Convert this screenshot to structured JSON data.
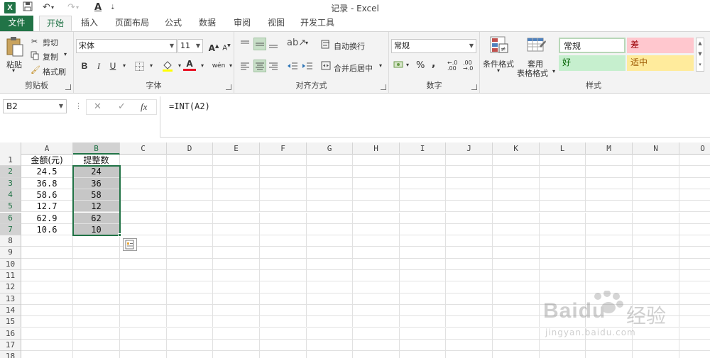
{
  "app": {
    "title": "记录 - Excel",
    "logo_letter": "X"
  },
  "tabs": [
    "文件",
    "开始",
    "插入",
    "页面布局",
    "公式",
    "数据",
    "审阅",
    "视图",
    "开发工具"
  ],
  "ribbon": {
    "clipboard": {
      "paste": "粘贴",
      "cut": "剪切",
      "copy": "复制",
      "format_painter": "格式刷",
      "label": "剪贴板"
    },
    "font": {
      "name": "宋体",
      "size": "11",
      "bold": "B",
      "italic": "I",
      "underline": "U",
      "font_color_letter": "A",
      "wen": "wén",
      "label": "字体"
    },
    "alignment": {
      "wrap": "自动换行",
      "merge": "合并后居中",
      "label": "对齐方式"
    },
    "number": {
      "format": "常规",
      "percent": "%",
      "comma": ",",
      "label": "数字"
    },
    "styles": {
      "conditional": "条件格式",
      "table1": "套用",
      "table2": "表格格式",
      "normal": "常规",
      "bad": "差",
      "good": "好",
      "neutral": "适中",
      "label": "样式"
    }
  },
  "formula_bar": {
    "name_box": "B2",
    "formula": "=INT(A2)",
    "fx": "fx"
  },
  "sheet": {
    "columns": [
      "A",
      "B",
      "C",
      "D",
      "E",
      "F",
      "G",
      "H",
      "I",
      "J",
      "K",
      "L",
      "M",
      "N",
      "O"
    ],
    "row_numbers": [
      "1",
      "2",
      "3",
      "4",
      "5",
      "6",
      "7",
      "8",
      "9",
      "10",
      "11",
      "12",
      "13",
      "14",
      "15",
      "16",
      "17",
      "18"
    ],
    "rows": [
      [
        "金额(元)",
        "提整数"
      ],
      [
        "24.5",
        "24"
      ],
      [
        "36.8",
        "36"
      ],
      [
        "58.6",
        "58"
      ],
      [
        "12.7",
        "12"
      ],
      [
        "62.9",
        "62"
      ],
      [
        "10.6",
        "10"
      ]
    ]
  },
  "watermark": {
    "brand": "Baidu",
    "cn": "经验",
    "url": "jingyan.baidu.com"
  },
  "colors": {
    "excel_green": "#217346",
    "bad_bg": "#ffc7ce",
    "bad_fg": "#9c0006",
    "good_bg": "#c6efce",
    "neutral_bg": "#ffeb9c",
    "neutral_fg": "#9c5700"
  }
}
